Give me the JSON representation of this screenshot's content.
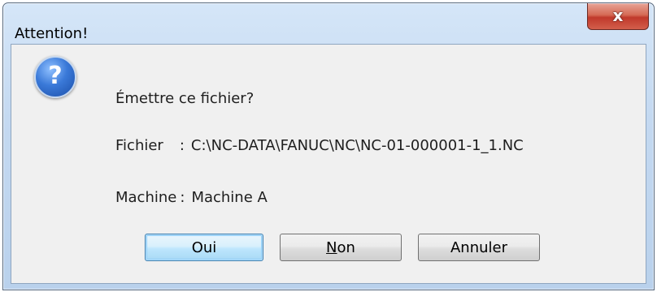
{
  "window": {
    "title": "Attention!",
    "close_symbol": "x"
  },
  "icon": {
    "name": "question-icon",
    "glyph": "?"
  },
  "message": {
    "question": "Émettre ce fichier?",
    "file_label": "Fichier",
    "file_colon": ":",
    "file_value": "C:\\NC-DATA\\FANUC\\NC\\NC-01-000001-1_1.NC",
    "machine_label": "Machine",
    "machine_colon": ":",
    "machine_value": "Machine A"
  },
  "buttons": {
    "yes": "Oui",
    "no_mnemonic": "N",
    "no_rest": "on",
    "cancel": "Annuler"
  },
  "colors": {
    "title_bar": "#c4d9f1",
    "client_bg": "#f0f0f0",
    "close_button": "#c0392b",
    "default_button_border": "#3c7fb1"
  }
}
